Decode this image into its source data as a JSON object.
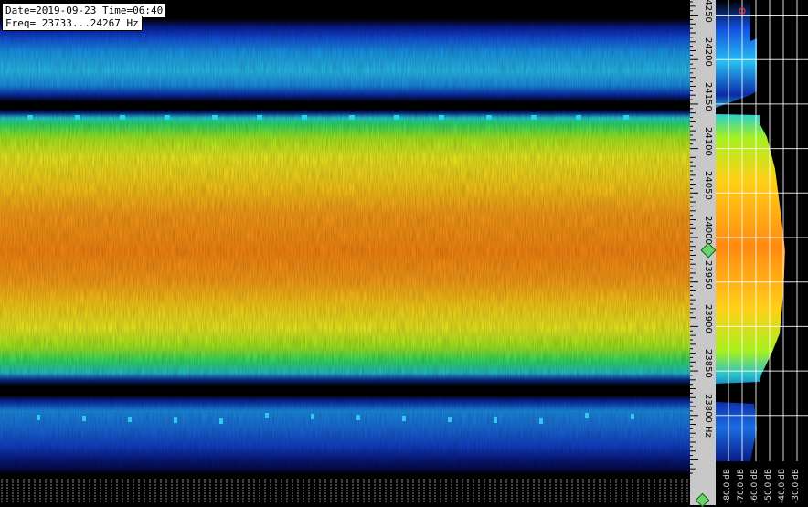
{
  "info": {
    "date_time": "Date=2019-09-23 Time=06:40",
    "freq_range": "Freq= 23733...24267 Hz"
  },
  "frequency_axis": {
    "min_hz": 23733,
    "max_hz": 24267,
    "labels": [
      "24250",
      "24200",
      "24150",
      "24100",
      "24050",
      "24000",
      "23950",
      "23900",
      "23850",
      "23800 Hz"
    ],
    "values": [
      24250,
      24200,
      24150,
      24100,
      24050,
      24000,
      23950,
      23900,
      23850,
      23800
    ]
  },
  "level_axis": {
    "labels": [
      "-80.0 dB",
      "-70.0 dB",
      "-60.0 dB",
      "-50.0 dB",
      "-40.0 dB",
      "-30.0 dB"
    ]
  },
  "colors": {
    "scale_bg": "#c8c8c8",
    "gridline": "#ffffff",
    "marker": "#6ad46a"
  }
}
